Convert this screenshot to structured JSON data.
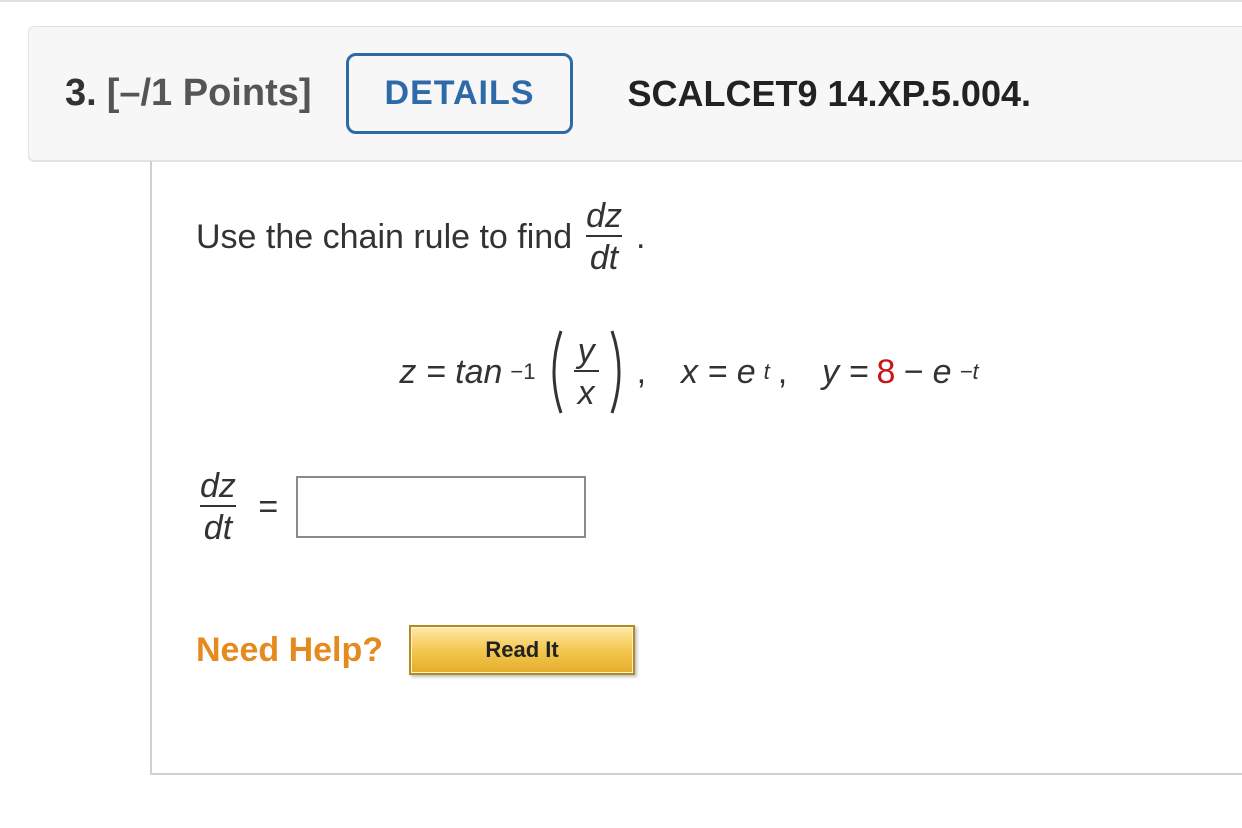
{
  "header": {
    "number": "3.",
    "points": "[–/1 Points]",
    "details_label": "DETAILS",
    "reference": "SCALCET9 14.XP.5.004."
  },
  "instruction": {
    "prefix": "Use the chain rule to find ",
    "frac_num": "dz",
    "frac_den": "dt",
    "suffix": "."
  },
  "equation": {
    "z_lead": "z = tan",
    "tan_exp": "−1",
    "yx_num": "y",
    "yx_den": "x",
    "comma": ",  ",
    "x_part": "x = e",
    "x_exp": "t",
    "x_after": ",  ",
    "y_lead": "y = ",
    "y_const": "8",
    "y_mid": " − e",
    "y_exp": "−t"
  },
  "answer": {
    "frac_num": "dz",
    "frac_den": "dt",
    "equals": "="
  },
  "help": {
    "label": "Need Help?",
    "read_label": "Read It"
  }
}
